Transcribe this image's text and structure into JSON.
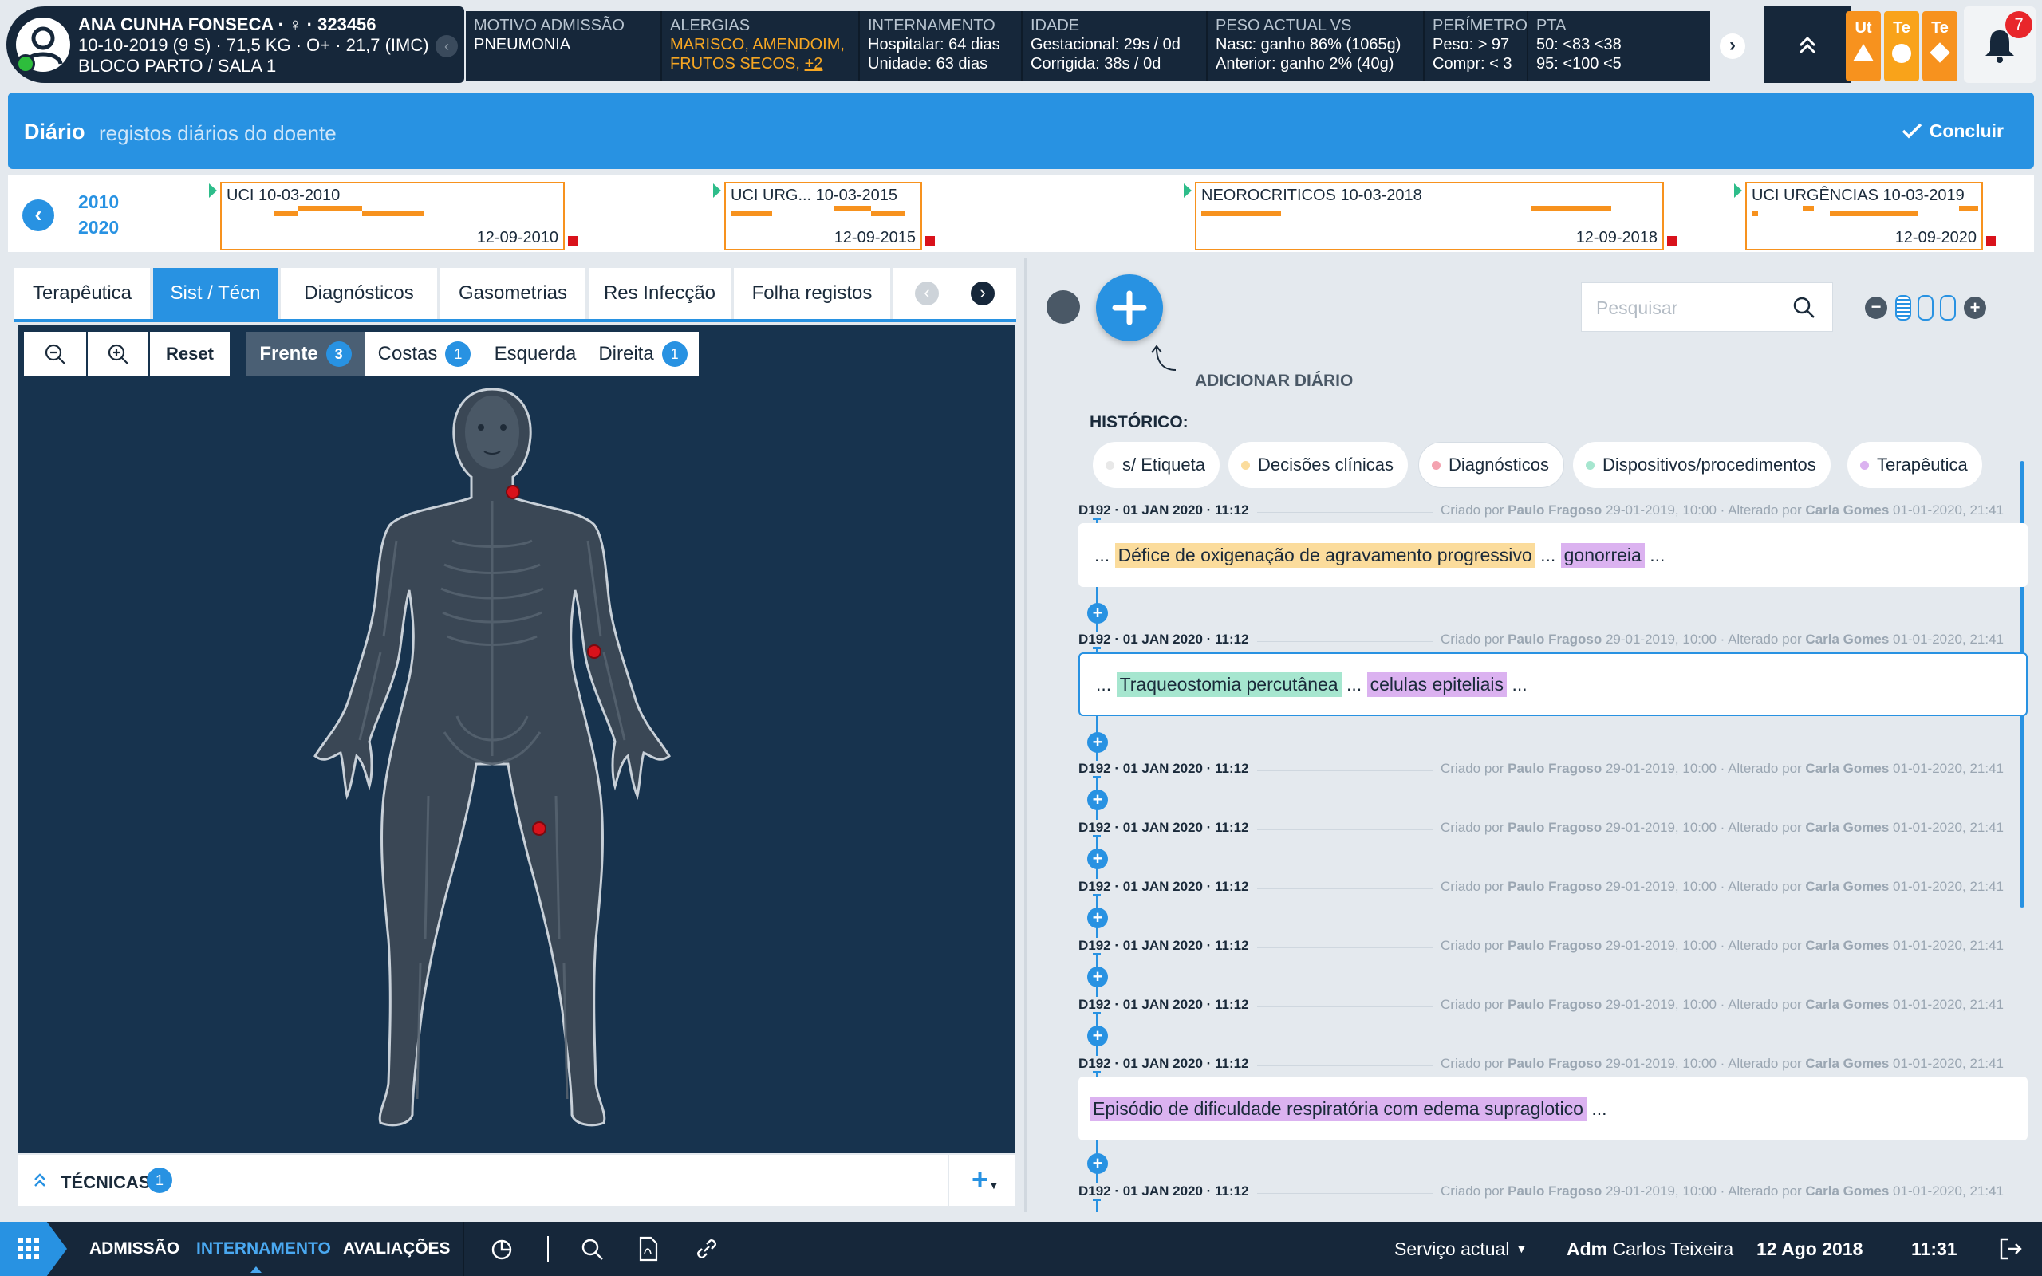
{
  "patient": {
    "name": "ANA CUNHA FONSECA",
    "id": "323456",
    "line2": "10-10-2019 (9 S) · 71,5 KG · O+ · 21,7 (IMC)",
    "location": "BLOCO PARTO / SALA 1"
  },
  "info": {
    "motivo_label": "MOTIVO ADMISSÃO",
    "motivo_value": "PNEUMONIA",
    "alergias_label": "ALERGIAS",
    "alergias_line1": "MARISCO, AMENDOIM,",
    "alergias_line2": "FRUTOS SECOS,",
    "alergias_more": "+2",
    "intern_label": "INTERNAMENTO",
    "intern_line1": "Hospitalar: 64 dias",
    "intern_line2": "Unidade: 63 dias",
    "idade_label": "IDADE",
    "idade_line1": "Gestacional: 29s / 0d",
    "idade_line2": "Corrigida: 38s / 0d",
    "peso_label": "PESO ACTUAL VS",
    "peso_line1": "Nasc: ganho 86% (1065g)",
    "peso_line2": "Anterior: ganho 2% (40g)",
    "perim_label": "PERÍMETRO",
    "perim_line1": "Peso: > 97",
    "perim_line2": "Compr: < 3",
    "pta_label": "PTA",
    "pta_line1": "50: <83 <38",
    "pta_line2": "95: <100 <5"
  },
  "tiles": [
    "Ut",
    "Te",
    "Te"
  ],
  "notifications_count": "7",
  "diary": {
    "title": "Diário",
    "subtitle": "registos diários do doente",
    "conclude": "Concluir"
  },
  "timeline": {
    "year_start": "2010",
    "year_end": "2020",
    "segments": [
      {
        "title": "UCI 10-03-2010",
        "end": "12-09-2010"
      },
      {
        "title": "UCI URG... 10-03-2015",
        "end": "12-09-2015"
      },
      {
        "title": "NEOROCRITICOS 10-03-2018",
        "end": "12-09-2018"
      },
      {
        "title": "UCI URGÊNCIAS 10-03-2019",
        "end": "12-09-2020"
      }
    ]
  },
  "tabs": [
    "Terapêutica",
    "Sist / Técn",
    "Diagnósticos",
    "Gasometrias",
    "Res Infecção",
    "Folha registos"
  ],
  "toolbar": {
    "reset": "Reset",
    "views": [
      {
        "label": "Frente",
        "count": "3"
      },
      {
        "label": "Costas",
        "count": "1"
      },
      {
        "label": "Esquerda",
        "count": ""
      },
      {
        "label": "Direita",
        "count": "1"
      }
    ]
  },
  "tecnicas": {
    "label": "TÉCNICAS",
    "count": "1"
  },
  "right": {
    "add_label": "ADICIONAR DIÁRIO",
    "search_placeholder": "Pesquisar",
    "historico": "HISTÓRICO:",
    "filters": [
      {
        "label": "s/ Etiqueta",
        "color": "#e8e8e8"
      },
      {
        "label": "Decisões clínicas",
        "color": "#fbdc9c"
      },
      {
        "label": "Diagnósticos",
        "color": "#f4a3b0"
      },
      {
        "label": "Dispositivos/procedimentos",
        "color": "#a6e6cf"
      },
      {
        "label": "Terapêutica",
        "color": "#dbb2f0"
      }
    ],
    "entry_date": "D192 · 01 JAN 2020 · 11:12",
    "created_prefix": "Criado por",
    "created_by": "Paulo Fragoso",
    "created_at": "29-01-2019, 10:00 · Alterado por",
    "altered_by": "Carla Gomes",
    "altered_at": "01-01-2020, 21:41",
    "card1": {
      "pre": "...",
      "h1": "Défice de oxigenação de agravamento progressivo",
      "mid": "...",
      "h2": "gonorreia",
      "post": "..."
    },
    "card2": {
      "pre": "...",
      "h1": "Traqueostomia percutânea",
      "mid": "...",
      "h2": "celulas epiteliais",
      "post": "..."
    },
    "card3": {
      "h1": "Episódio de dificuldade respiratória com edema supraglotico",
      "post": "..."
    }
  },
  "bottom": {
    "nav": [
      "ADMISSÃO",
      "INTERNAMENTO",
      "AVALIAÇÕES"
    ],
    "service": "Serviço actual",
    "user_role": "Adm",
    "user_name": "Carlos Teixeira",
    "date": "12 Ago 2018",
    "time": "11:31"
  }
}
